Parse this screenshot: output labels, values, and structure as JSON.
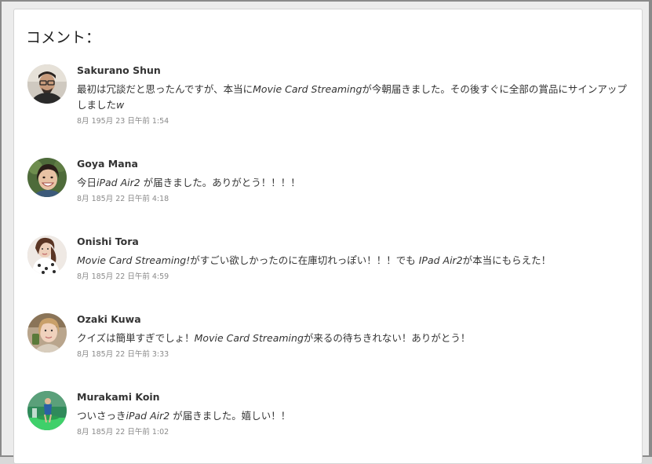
{
  "section": {
    "title": "コメント："
  },
  "comments": [
    {
      "name": "Sakurano Shun",
      "parts": [
        {
          "t": "最初は冗談だと思ったんですが、本当に",
          "i": false
        },
        {
          "t": "Movie Card Streaming",
          "i": true
        },
        {
          "t": "が今朝届きました。その後すぐに全部の賞品にサインアップしました",
          "i": false
        },
        {
          "t": "w",
          "i": true
        }
      ],
      "date": "8月 195月 23 日午前 1:54",
      "avatar": "avatar-man-glasses"
    },
    {
      "name": "Goya Mana",
      "parts": [
        {
          "t": "今日",
          "i": false
        },
        {
          "t": "iPad Air2",
          "i": true
        },
        {
          "t": " が届きました。ありがとう！！！！",
          "i": false
        }
      ],
      "date": "8月 185月 22 日午前 4:18",
      "avatar": "avatar-woman-smiling"
    },
    {
      "name": "Onishi Tora",
      "parts": [
        {
          "t": "Movie Card Streaming!",
          "i": true
        },
        {
          "t": "がすごい欲しかったのに在庫切れっぽい！！！でも ",
          "i": false
        },
        {
          "t": "IPad Air2",
          "i": true
        },
        {
          "t": "が本当にもらえた！",
          "i": false
        }
      ],
      "date": "8月 185月 22 日午前 4:59",
      "avatar": "avatar-woman-posing"
    },
    {
      "name": "Ozaki Kuwa",
      "parts": [
        {
          "t": "クイズは簡単すぎでしょ！",
          "i": false
        },
        {
          "t": "Movie Card Streaming",
          "i": true
        },
        {
          "t": "が来るの待ちきれない！ありがとう！",
          "i": false
        }
      ],
      "date": "8月 185月 22 日午前 3:33",
      "avatar": "avatar-woman-selfie"
    },
    {
      "name": "Murakami Koin",
      "parts": [
        {
          "t": "ついさっき",
          "i": false
        },
        {
          "t": "iPad Air2",
          "i": true
        },
        {
          "t": " が届きました。嬉しい！！",
          "i": false
        }
      ],
      "date": "8月 185月 22 日午前 1:02",
      "avatar": "avatar-person-outdoor"
    }
  ]
}
